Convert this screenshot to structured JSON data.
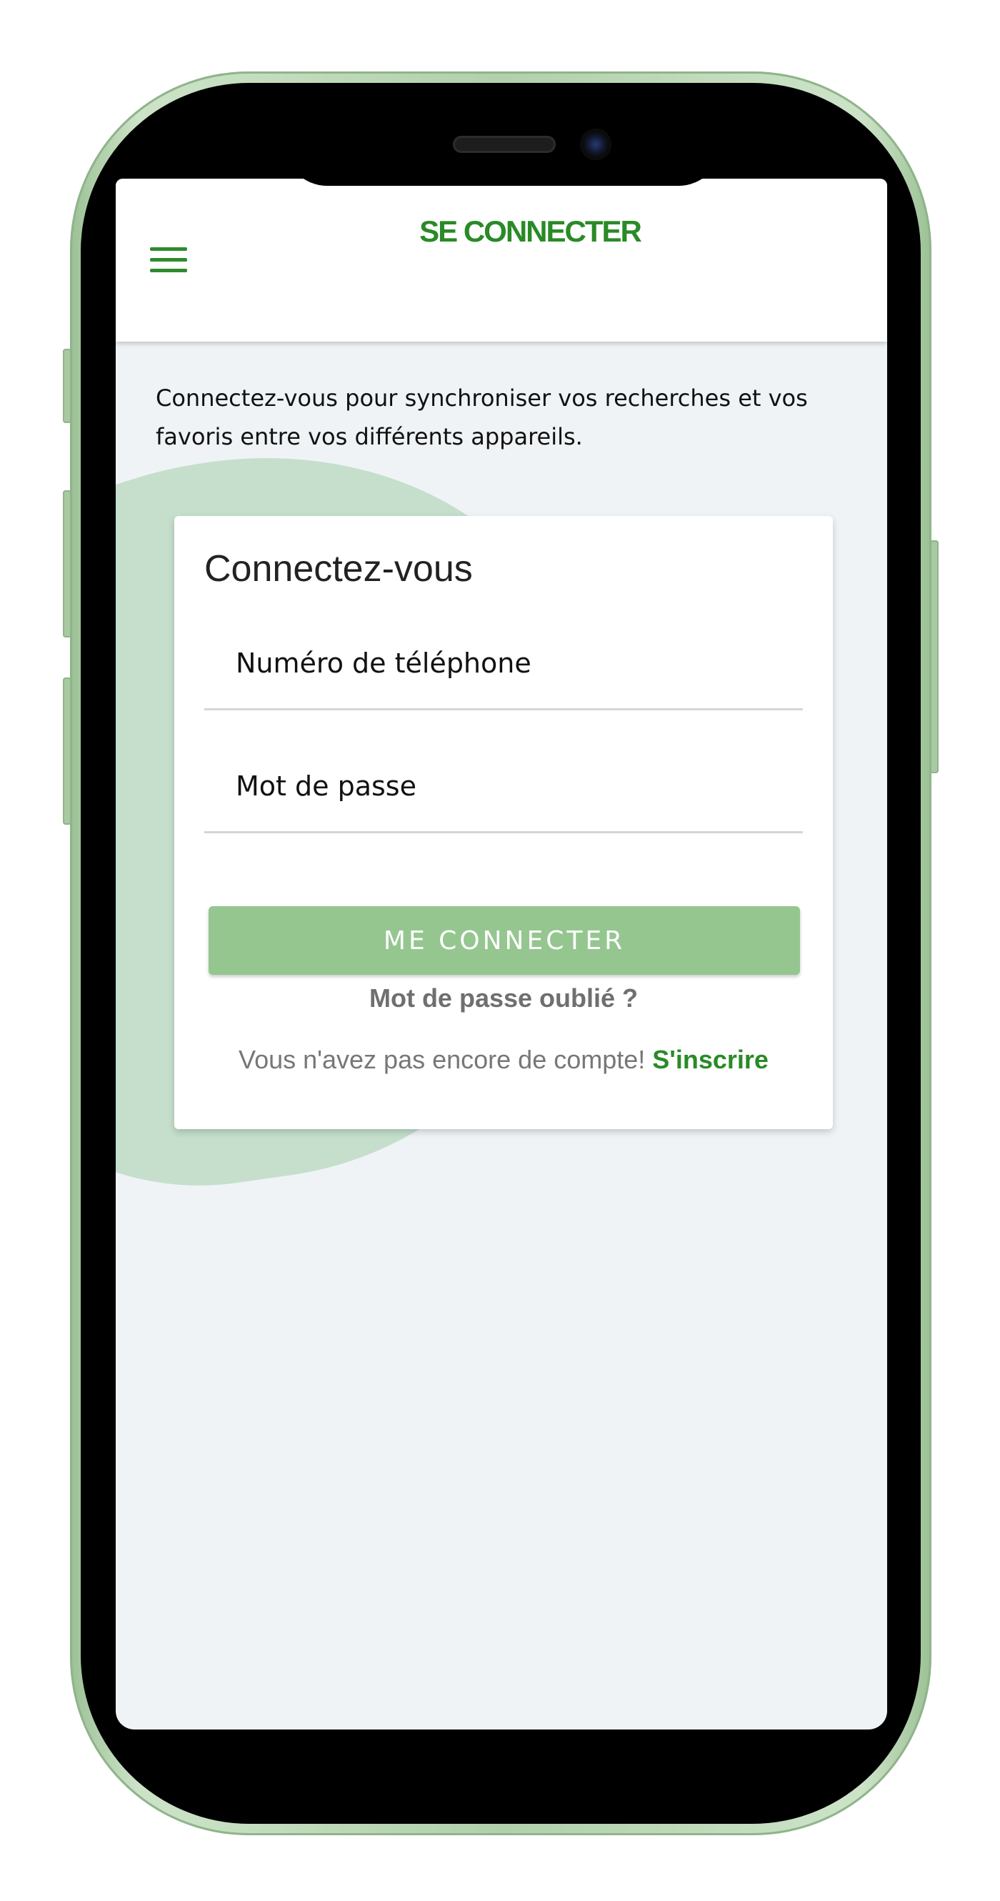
{
  "header": {
    "title": "SE CONNECTER"
  },
  "intro": {
    "text": "Connectez-vous pour synchroniser vos recherches et vos favoris entre vos différents appareils."
  },
  "login_card": {
    "title": "Connectez-vous",
    "phone_placeholder": "Numéro de téléphone",
    "phone_value": "",
    "password_placeholder": "Mot de passe",
    "password_value": "",
    "submit_label": "ME CONNECTER",
    "forgot_label": "Mot de passe oublié ?",
    "no_account_text": "Vous n'avez pas encore de compte! ",
    "signup_label": "S'inscrire"
  },
  "icons": {
    "menu": "hamburger-menu-icon"
  },
  "colors": {
    "brand_green": "#2a8a27",
    "button_green": "#95c690",
    "blob_green": "#c5dfcc",
    "background": "#eff3f6",
    "phone_frame": "#b1d0ab"
  }
}
